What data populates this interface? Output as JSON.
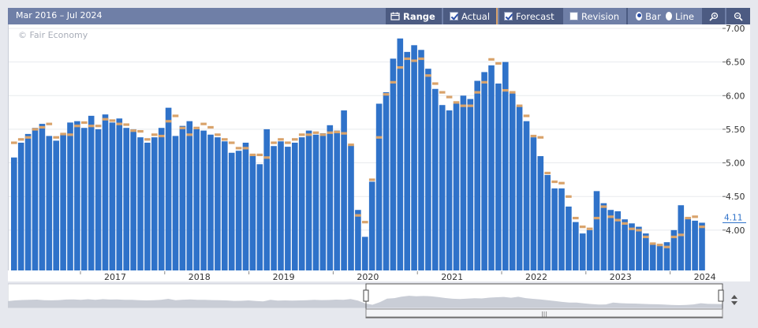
{
  "toolbar": {
    "range_text": "Mar 2016 – Jul 2024",
    "range_label": "Range",
    "actual_label": "Actual",
    "forecast_label": "Forecast",
    "revision_label": "Revision",
    "bar_label": "Bar",
    "line_label": "Line",
    "actual_checked": true,
    "forecast_checked": true,
    "revision_checked": false,
    "chart_mode": "bar"
  },
  "watermark": "© Fair Economy",
  "colors": {
    "bar": "#2f72c9",
    "forecast": "#d9a36b",
    "toolbar": "#6f7fa7",
    "nav_fill": "#c9cdd6"
  },
  "current_value_label": "4.11",
  "chart_data": {
    "type": "bar",
    "title": "",
    "xlabel": "",
    "ylabel": "",
    "ylim": [
      3.4,
      7.0
    ],
    "yticks": [
      "7.00",
      "6.50",
      "6.00",
      "5.50",
      "5.00",
      "4.50",
      "4.00"
    ],
    "ytick_values": [
      7.0,
      6.5,
      6.0,
      5.5,
      5.0,
      4.5,
      4.0
    ],
    "x_start": "2016-03",
    "x_end": "2024-07",
    "x_tick_labels": [
      "2017",
      "2018",
      "2019",
      "2020",
      "2021",
      "2022",
      "2023",
      "2024"
    ],
    "series": [
      {
        "values": [
          5.08,
          5.3,
          5.43,
          5.52,
          5.58,
          5.4,
          5.33,
          5.42,
          5.6,
          5.62,
          5.52,
          5.7,
          5.5,
          5.72,
          5.6,
          5.66,
          5.52,
          5.5,
          5.38,
          5.3,
          5.38,
          5.52,
          5.82,
          5.4,
          5.55,
          5.62,
          5.5,
          5.48,
          5.42,
          5.38,
          5.32,
          5.15,
          5.18,
          5.3,
          5.12,
          4.98,
          5.5,
          5.25,
          5.32,
          5.24,
          5.3,
          5.38,
          5.48,
          5.42,
          5.44,
          5.56,
          5.48,
          5.78,
          5.26,
          4.3,
          3.9,
          4.72,
          5.88,
          6.05,
          6.55,
          6.85,
          6.65,
          6.75,
          6.68,
          6.4,
          6.1,
          5.86,
          5.78,
          5.88,
          6.0,
          5.95,
          6.22,
          6.35,
          6.45,
          6.18,
          6.5,
          6.05,
          5.84,
          5.62,
          5.38,
          5.1,
          4.82,
          4.62,
          4.62,
          4.35,
          4.12,
          3.95,
          4.0,
          4.58,
          4.4,
          4.3,
          4.28,
          4.16,
          4.1,
          4.05,
          3.95,
          3.8,
          3.77,
          3.82,
          4.0,
          4.37,
          4.18,
          4.14,
          4.11
        ]
      },
      {
        "values": [
          5.3,
          5.35,
          5.38,
          5.5,
          5.53,
          5.58,
          5.38,
          5.43,
          5.42,
          5.55,
          5.6,
          5.55,
          5.55,
          5.65,
          5.63,
          5.58,
          5.57,
          5.48,
          5.47,
          5.35,
          5.42,
          5.4,
          5.62,
          5.7,
          5.52,
          5.42,
          5.52,
          5.58,
          5.53,
          5.42,
          5.35,
          5.3,
          5.22,
          5.22,
          5.12,
          5.12,
          5.08,
          5.3,
          5.35,
          5.3,
          5.35,
          5.42,
          5.42,
          5.45,
          5.42,
          5.45,
          5.46,
          5.44,
          5.27,
          4.22,
          4.12,
          4.75,
          5.38,
          6.02,
          6.2,
          6.42,
          6.55,
          6.52,
          6.55,
          6.3,
          6.18,
          6.05,
          5.98,
          5.9,
          5.85,
          5.85,
          6.05,
          6.2,
          6.54,
          6.48,
          6.08,
          6.05,
          5.85,
          5.7,
          5.4,
          5.38,
          4.85,
          4.72,
          4.7,
          4.5,
          4.18,
          4.05,
          4.02,
          4.18,
          4.35,
          4.2,
          4.15,
          4.1,
          4.02,
          4.0,
          3.9,
          3.8,
          3.78,
          3.75,
          3.9,
          3.93,
          4.18,
          4.2,
          4.05
        ]
      }
    ]
  }
}
